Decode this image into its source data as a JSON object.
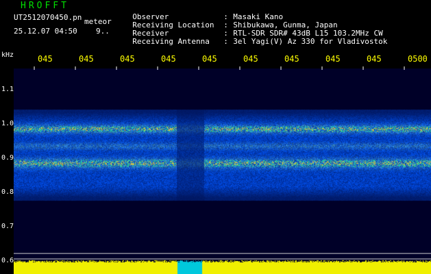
{
  "header": {
    "app_title": "HROFFT",
    "file_name": "UT2512070450.pn",
    "meteor_label": "meteor",
    "timestamp": "25.12.07 04:50",
    "count": "9..",
    "info": [
      {
        "label": "Observer",
        "value": "Masaki Kano"
      },
      {
        "label": "Receiving Location",
        "value": "Shibukawa, Gunma, Japan"
      },
      {
        "label": "Receiver",
        "value": "RTL-SDR SDR# 43dB L15 103.2MHz CW"
      },
      {
        "label": "Receiving Antenna",
        "value": "3el Yagi(V) Az 330 for Vladivostok"
      }
    ]
  },
  "axes": {
    "y_unit": "kHz",
    "x_ticks": [
      "045",
      "045",
      "045",
      "045",
      "045",
      "045",
      "045",
      "045",
      "045",
      "0500"
    ],
    "y_ticks": [
      "1.1",
      "1.0",
      "0.9",
      "0.8",
      "0.7",
      "0.6"
    ]
  },
  "colors": {
    "background": "#000000",
    "noise_blue": "#1b2fd0",
    "signal_yellow": "#ffff00",
    "title_green": "#00e000",
    "tick_yellow": "#ffff00"
  }
}
